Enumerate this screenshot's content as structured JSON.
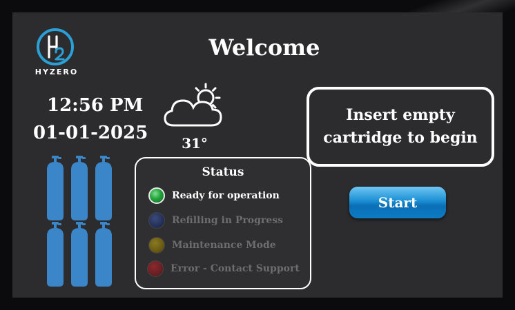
{
  "brand": {
    "name": "HYZERO"
  },
  "header": {
    "title": "Welcome"
  },
  "clock": {
    "time": "12:56 PM",
    "date": "01-01-2025"
  },
  "weather": {
    "temperature": "31°",
    "icon": "partly-cloudy-icon"
  },
  "prompt": {
    "line1": "Insert empty",
    "line2": "cartridge to begin"
  },
  "actions": {
    "start_label": "Start"
  },
  "tanks": {
    "count": 6,
    "color": "#3a86c8"
  },
  "status": {
    "title": "Status",
    "items": [
      {
        "label": "Ready for operation",
        "color": "#1f9a3a",
        "active": true
      },
      {
        "label": "Refilling in Progress",
        "color": "#2a3a66",
        "active": false
      },
      {
        "label": "Maintenance Mode",
        "color": "#6a5a12",
        "active": false
      },
      {
        "label": "Error - Contact Support",
        "color": "#6a1e22",
        "active": false
      }
    ]
  },
  "colors": {
    "accent": "#1b8fd3",
    "background": "#2c2b2d",
    "brand": "#2aa0d6"
  }
}
